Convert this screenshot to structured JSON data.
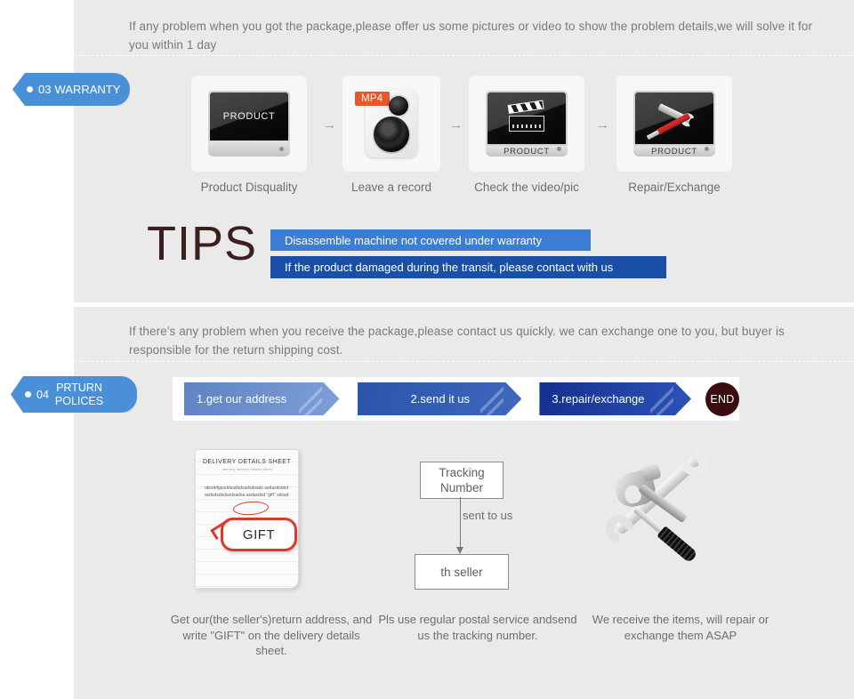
{
  "theme": {
    "panel_bg": "#eaeaea",
    "badge_blue": "#4a90d9",
    "tip_light_blue": "#3c7ed6",
    "tip_dark_blue": "#1a4fa8",
    "accent_orange": "#e8562a",
    "end_maroon": "#3a0d11"
  },
  "warranty": {
    "badge": {
      "number": "03",
      "label": "WARRANTY"
    },
    "intro": "If any problem when you got the package,please offer us some pictures or video to show the problem details,we will solve it for you within 1 day",
    "steps": [
      {
        "caption": "Product Disquality",
        "icon": "monitor-product-icon",
        "screen_label": "PRODUCT"
      },
      {
        "caption": "Leave a record",
        "icon": "camera-icon",
        "badge": "MP4"
      },
      {
        "caption": "Check the video/pic",
        "icon": "clapperboard-screen-icon",
        "bezel_label": "PRODUCT"
      },
      {
        "caption": "Repair/Exchange",
        "icon": "tools-screen-icon",
        "bezel_label": "PRODUCT"
      }
    ],
    "arrow_glyph": "→",
    "tips": {
      "heading": "TIPS",
      "lines": [
        "Disassemble machine not covered under warranty",
        "If the product damaged during the transit, please contact with us"
      ]
    }
  },
  "returns": {
    "badge": {
      "number": "04",
      "label_line1": "PRTURN",
      "label_line2": "POLICES"
    },
    "intro": "If  there's any problem when you receive the package,please contact us quickly. we can exchange one to you, but buyer is responsible for the return shipping cost.",
    "steps": [
      {
        "label": "1.get our address"
      },
      {
        "label": "2.send it us"
      },
      {
        "label": "3.repair/exchange"
      }
    ],
    "end_label": "END",
    "columns": [
      {
        "icon": "delivery-details-sheet-icon",
        "sheet": {
          "title": "DELIVERY DETAILS SHEET",
          "subtitle": "delivery        delivery details sheet",
          "body": "abcdefgasddsadsdsadsdsads asdasdsdsdsedsdsdsdasdsadsa asdasdsd \"gift\" sdsad",
          "bubble_label": "GIFT"
        },
        "caption": "Get our(the seller's)return address, and write \"GIFT\" on the delivery details sheet."
      },
      {
        "icon": "tracking-flow-icon",
        "flow": {
          "from": "Tracking Number",
          "edge": "sent to us",
          "to": "th seller"
        },
        "caption": "Pls use regular postal service andsend us the tracking number."
      },
      {
        "icon": "hammer-wrench-screwdriver-icon",
        "caption": "We receive the items, will repair or exchange them ASAP"
      }
    ]
  }
}
